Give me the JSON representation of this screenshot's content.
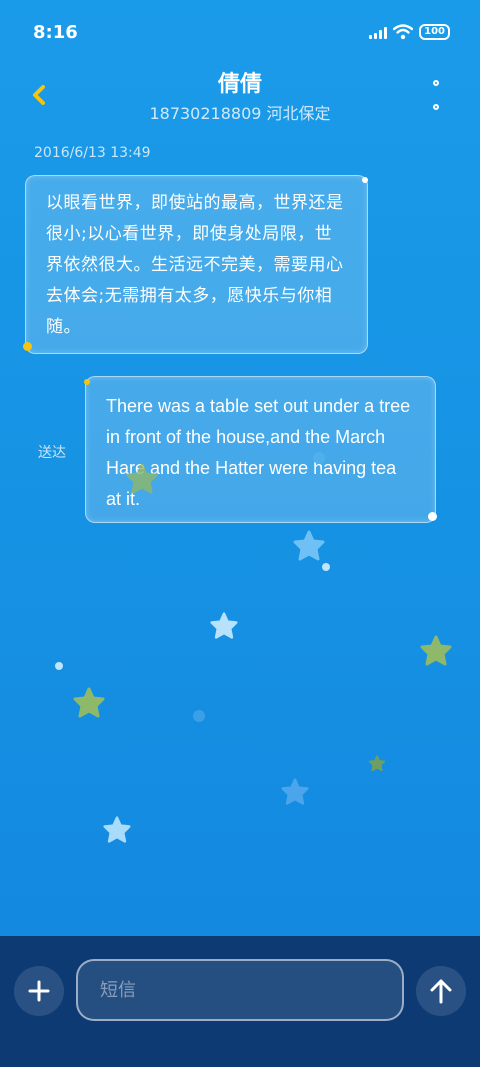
{
  "status_bar": {
    "time": "8:16",
    "battery": "100"
  },
  "header": {
    "contact_name": "倩倩",
    "contact_info": "18730218809 河北保定"
  },
  "messages": {
    "timestamp": "2016/6/13 13:49",
    "received_text": "以眼看世界，即使站的最高，世界还是很小;以心看世界，即使身处局限，世界依然很大。生活远不完美，需要用心去体会;无需拥有太多，愿快乐与你相随。",
    "sent_text": "There was a table set out under a tree in front of the house,and the March Hare and the Hatter were having tea at it.",
    "sent_status": "送达"
  },
  "composer": {
    "placeholder": "短信"
  },
  "icons": {
    "back": "chevron-left-icon",
    "more": "more-vertical-icon",
    "add": "plus-icon",
    "send": "arrow-up-icon"
  },
  "colors": {
    "accent_yellow": "#f6c40f",
    "background": "#1691e3",
    "composer_bg": "#0d3a73"
  }
}
